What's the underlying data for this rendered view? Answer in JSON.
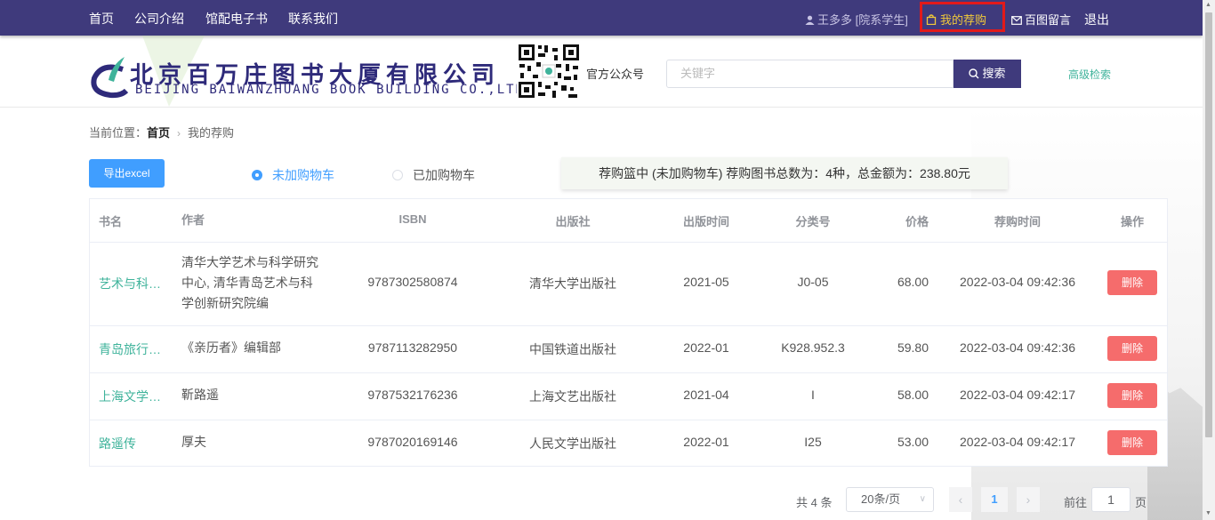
{
  "nav": {
    "items": [
      "首页",
      "公司介绍",
      "馆配电子书",
      "联系我们"
    ],
    "user": "王多多 [院系学生]",
    "my_purchase": "我的荐购",
    "message": "百图留言",
    "logout": "退出"
  },
  "header": {
    "logo_cn": "北京百万庄图书大厦有限公司",
    "logo_en": "BEIJING BAIWANZHUANG BOOK BUILDING CO.,LTD.",
    "qr_label": "官方公众号",
    "search_placeholder": "关键字",
    "search_button": "搜索",
    "advanced_search": "高级检索"
  },
  "breadcrumb": {
    "prefix": "当前位置：",
    "home": "首页",
    "current": "我的荐购"
  },
  "toolbar": {
    "export_label": "导出excel",
    "radio_not_added": "未加购物车",
    "radio_added": "已加购物车",
    "selected_radio": "未加购物车",
    "summary": "荐购篮中 (未加购物车) 荐购图书总数为：4种，总金额为：238.80元"
  },
  "table": {
    "columns": [
      "书名",
      "作者",
      "ISBN",
      "出版社",
      "出版时间",
      "分类号",
      "价格",
      "荐购时间",
      "操作"
    ],
    "rows": [
      {
        "title": "艺术与科…",
        "author": "清华大学艺术与科学研究中心, 清华青岛艺术与科学创新研究院编",
        "isbn": "9787302580874",
        "publisher": "清华大学出版社",
        "date": "2021-05",
        "class": "J0-05",
        "price": "68.00",
        "time": "2022-03-04 09:42:36",
        "action": "删除"
      },
      {
        "title": "青岛旅行…",
        "author": "《亲历者》编辑部",
        "isbn": "9787113282950",
        "publisher": "中国铁道出版社",
        "date": "2022-01",
        "class": "K928.952.3",
        "price": "59.80",
        "time": "2022-03-04 09:42:36",
        "action": "删除"
      },
      {
        "title": "上海文学…",
        "author": "靳路遥",
        "isbn": "9787532176236",
        "publisher": "上海文艺出版社",
        "date": "2021-04",
        "class": "I",
        "price": "58.00",
        "time": "2022-03-04 09:42:17",
        "action": "删除"
      },
      {
        "title": "路遥传",
        "author": "厚夫",
        "isbn": "9787020169146",
        "publisher": "人民文学出版社",
        "date": "2022-01",
        "class": "I25",
        "price": "53.00",
        "time": "2022-03-04 09:42:17",
        "action": "删除"
      }
    ]
  },
  "pagination": {
    "total": "共 4 条",
    "page_size": "20条/页",
    "current_page": "1",
    "goto_prefix": "前往",
    "goto_value": "1",
    "goto_suffix": "页"
  },
  "colors": {
    "nav_bg": "#3f3a7c",
    "accent_blue": "#409eff",
    "link_green": "#3fb39b",
    "danger": "#f56c6c",
    "highlight_box": "#e21a1a"
  }
}
